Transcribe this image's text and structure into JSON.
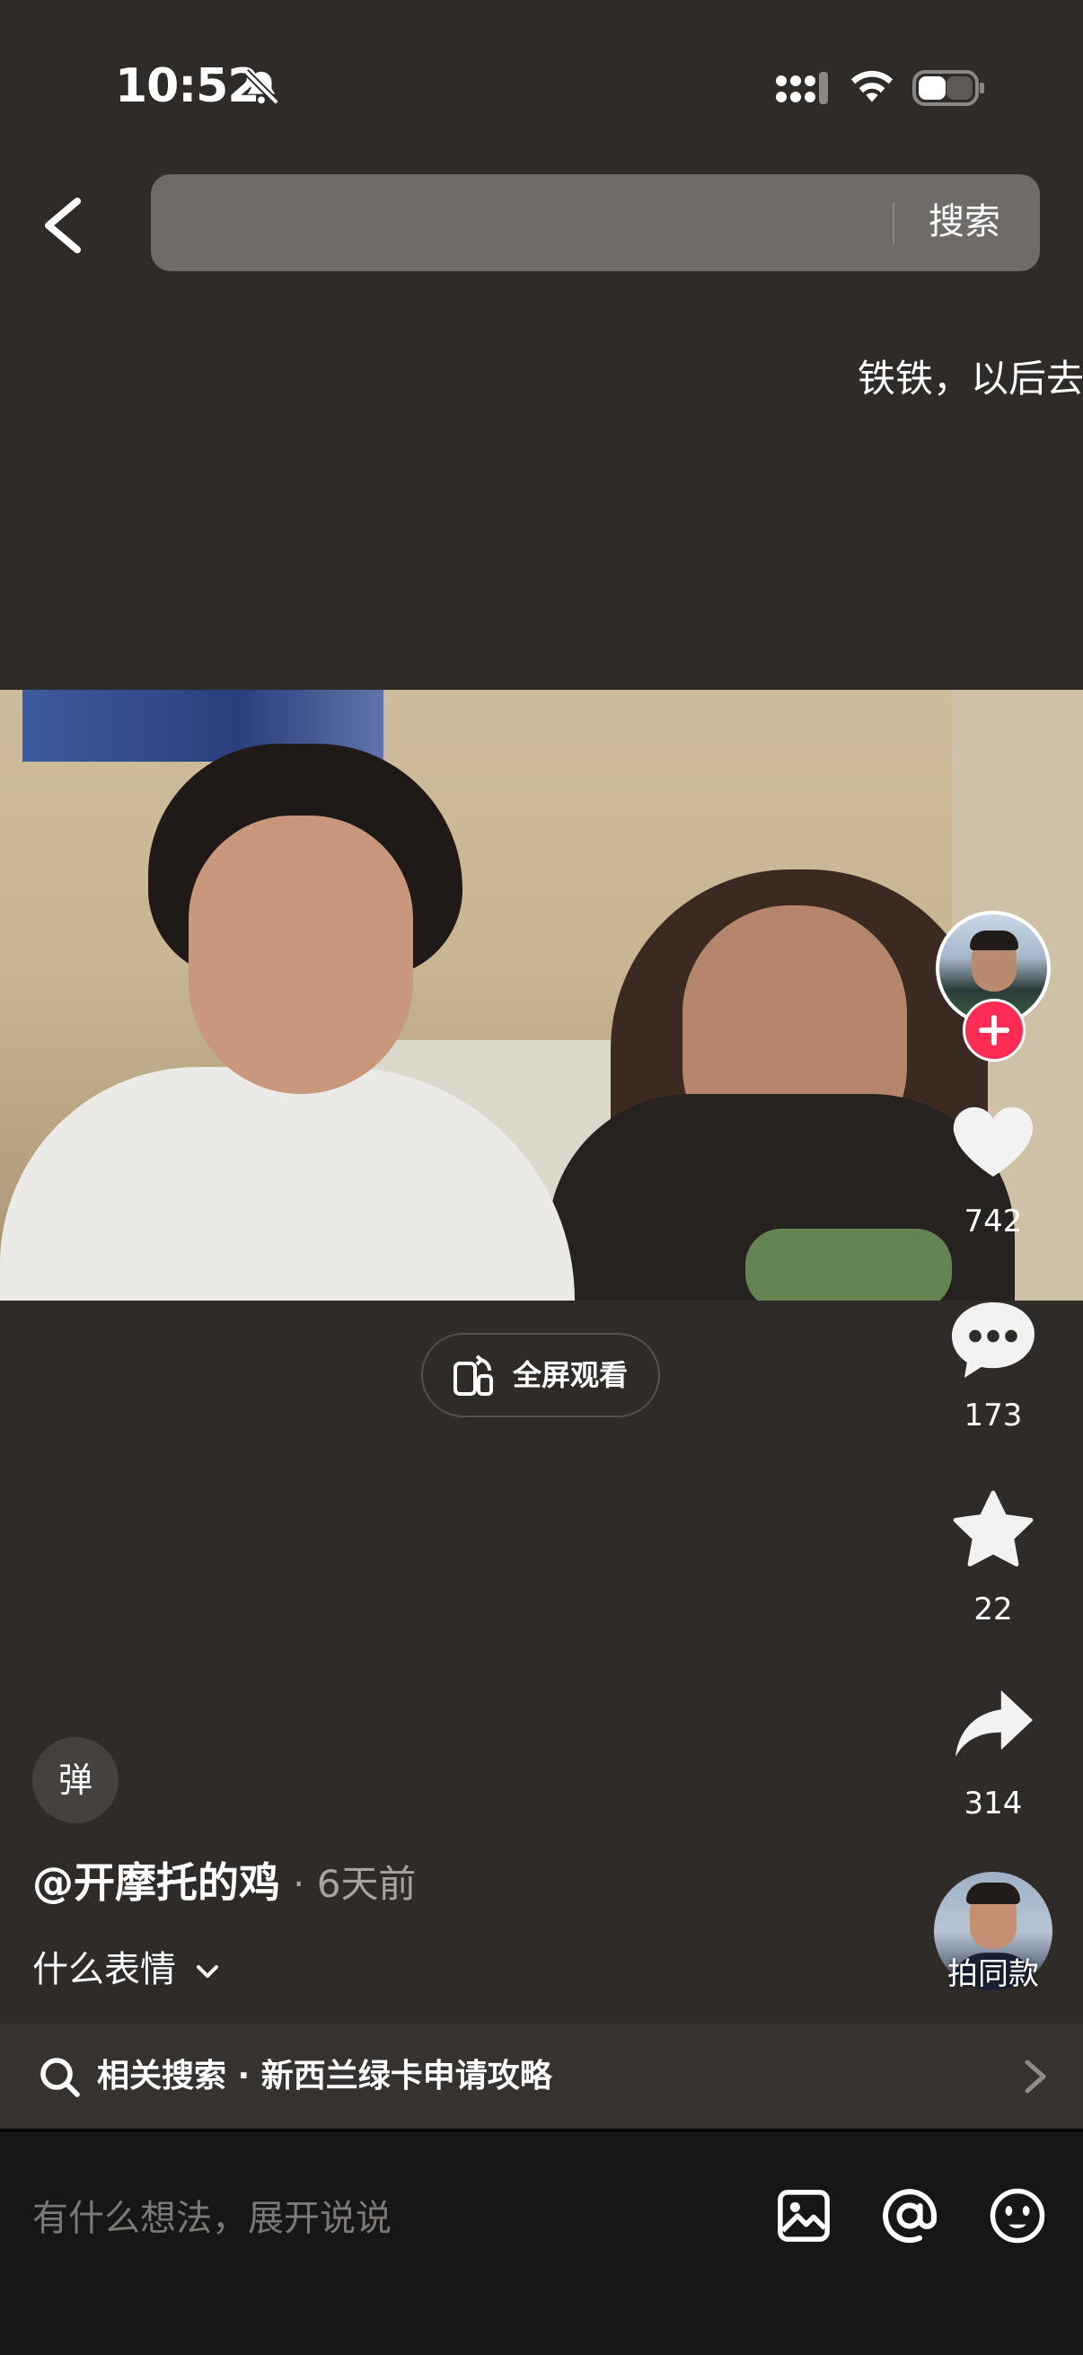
{
  "status_bar": {
    "time": "10:52"
  },
  "header": {
    "search_placeholder": "",
    "search_button": "搜索"
  },
  "danmu_text": "铁铁，以后去",
  "video": {
    "fullscreen_label": "全屏观看"
  },
  "rail": {
    "likes": "742",
    "comments": "173",
    "favorites": "22",
    "shares": "314",
    "remix_label": "拍同款"
  },
  "info": {
    "danmu_toggle": "弹",
    "author": "@开摩托的鸡",
    "time_ago": "· 6天前",
    "caption": "什么表情"
  },
  "related": {
    "text": "相关搜索 · 新西兰绿卡申请攻略"
  },
  "comment_bar": {
    "placeholder": "有什么想法，展开说说"
  },
  "colors": {
    "background": "#2f2b29",
    "accent_follow": "#fe2c55",
    "comment_bar": "#161616"
  },
  "icons": [
    "bell-off-icon",
    "signal-icon",
    "wifi-icon",
    "battery-icon",
    "back-icon",
    "heart-icon",
    "comment-icon",
    "star-icon",
    "share-icon",
    "search-icon",
    "chevron-right-icon",
    "image-icon",
    "at-icon",
    "emoji-icon",
    "plus-icon",
    "rotate-phone-icon"
  ]
}
